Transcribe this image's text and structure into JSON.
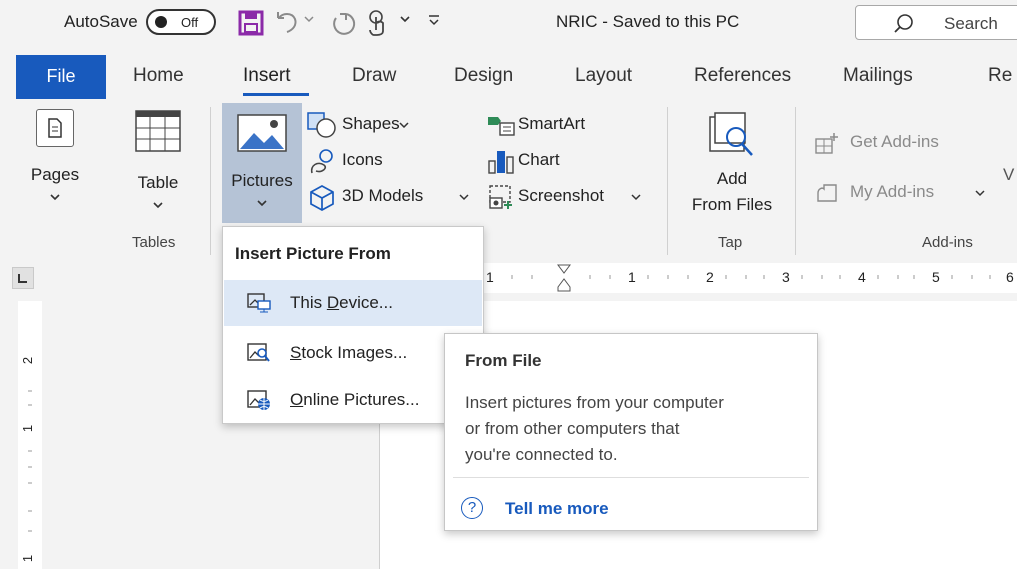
{
  "titlebar": {
    "autosave_label": "AutoSave",
    "autosave_state": "Off",
    "document_title": "NRIC  -  Saved to this PC",
    "search_placeholder": "Search",
    "accent": "#185abd",
    "save_icon_color": "#8b2aa8"
  },
  "tabs": {
    "file": "File",
    "home": "Home",
    "insert": "Insert",
    "draw": "Draw",
    "design": "Design",
    "layout": "Layout",
    "references": "References",
    "mailings": "Mailings",
    "review_partial": "Re"
  },
  "ribbon": {
    "pages": "Pages",
    "table": "Table",
    "pictures": "Pictures",
    "shapes": "Shapes",
    "icons": "Icons",
    "models_3d": "3D Models",
    "smartart": "SmartArt",
    "chart": "Chart",
    "screenshot": "Screenshot",
    "add_line1": "Add",
    "add_line2": "From Files",
    "get_addins": "Get Add-ins",
    "my_addins": "My Add-ins",
    "group_tables": "Tables",
    "group_tap": "Tap",
    "group_addins": "Add-ins",
    "partial_w": "V"
  },
  "ruler": {
    "labels": [
      "1",
      "1",
      "2",
      "3",
      "4",
      "5",
      "6"
    ],
    "vertical_labels": [
      "2",
      "1",
      "1"
    ]
  },
  "dropdown": {
    "header": "Insert Picture From",
    "items": [
      {
        "label": "This Device...",
        "access_key": "D",
        "highlighted": true
      },
      {
        "label": "Stock Images...",
        "access_key": "S",
        "highlighted": false
      },
      {
        "label": "Online Pictures...",
        "access_key": "O",
        "highlighted": false
      }
    ]
  },
  "tooltip": {
    "title": "From File",
    "description": "Insert pictures from your computer\nor from other computers that\nyou're connected to.",
    "help_glyph": "?",
    "link": "Tell me more"
  }
}
